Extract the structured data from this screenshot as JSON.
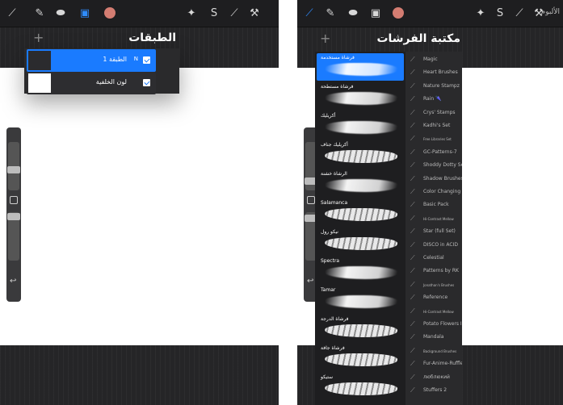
{
  "top_label": "الألبوم",
  "colors": {
    "accent": "#1a7bff",
    "current_color": "#d47d72",
    "canvas": "#ffffff",
    "panel": "#1b1b1d"
  },
  "icons": [
    "brush-icon",
    "smudge-icon",
    "eraser-icon",
    "layers-icon",
    "color-dot",
    "adjustments-icon",
    "selection-icon",
    "transform-icon",
    "wrench-icon"
  ],
  "layers": {
    "title": "الطبقات",
    "add_label": "+",
    "items": [
      {
        "name": "الطبقة 1",
        "mode": "N",
        "active": true,
        "thumbnail": "#2b2b2e"
      },
      {
        "name": "لون الخلفية",
        "mode": "",
        "active": false,
        "thumbnail": "#ffffff"
      }
    ]
  },
  "brush_library": {
    "title": "مكتبة الفرشات",
    "add_label": "+",
    "categories": [
      {
        "name": "فرشاة مستخدمة",
        "active": true,
        "style": "soft"
      },
      {
        "name": "فرشاة مستطحة",
        "active": false,
        "style": "soft"
      },
      {
        "name": "أكريليك",
        "active": false,
        "style": "soft"
      },
      {
        "name": "أكريليك جناف",
        "active": false,
        "style": "rough"
      },
      {
        "name": "الرشاة خشنة",
        "active": false,
        "style": "soft"
      },
      {
        "name": "Salamanca",
        "active": false,
        "style": "rough"
      },
      {
        "name": "نيكو رول",
        "active": false,
        "style": "rough"
      },
      {
        "name": "Spectra",
        "active": false,
        "style": "soft"
      },
      {
        "name": "Tamar",
        "active": false,
        "style": "soft"
      },
      {
        "name": "فرشاة الدرجة",
        "active": false,
        "style": "rough"
      },
      {
        "name": "فرشاة جافة",
        "active": false,
        "style": "rough"
      },
      {
        "name": "ستيكو",
        "active": false,
        "style": "rough"
      }
    ],
    "brush_sets": [
      {
        "name": "Magic",
        "tiny": false
      },
      {
        "name": "Heart Brushes",
        "tiny": false
      },
      {
        "name": "Nature Stampz",
        "tiny": false
      },
      {
        "name": "Rain 🌂",
        "tiny": false
      },
      {
        "name": "Crys' Stamps",
        "tiny": false
      },
      {
        "name": "Kadhi's Set",
        "tiny": false
      },
      {
        "name": "Free Libraries Set",
        "tiny": true
      },
      {
        "name": "GC-Patterns-7",
        "tiny": false
      },
      {
        "name": "Shoddy Dotty Set",
        "tiny": false
      },
      {
        "name": "Shadow Brushes",
        "tiny": false
      },
      {
        "name": "Color Changing",
        "tiny": false
      },
      {
        "name": "Basic Pack",
        "tiny": false
      },
      {
        "name": "Hi-Contrast Mellow",
        "tiny": true
      },
      {
        "name": "Star (full Set)",
        "tiny": false
      },
      {
        "name": "DISCO in ACID",
        "tiny": false
      },
      {
        "name": "Celestial",
        "tiny": false
      },
      {
        "name": "Patterns by RK",
        "tiny": false
      },
      {
        "name": "Jonathan's Brushes",
        "tiny": true
      },
      {
        "name": "Reference",
        "tiny": false
      },
      {
        "name": "Hi-Contrast Mellow",
        "tiny": true
      },
      {
        "name": "Potato Flowers III",
        "tiny": false
      },
      {
        "name": "Mandala",
        "tiny": false
      },
      {
        "name": "Background Brushes",
        "tiny": true
      },
      {
        "name": "Fur-Anime-Ruffles",
        "tiny": false
      },
      {
        "name": "люблюкий",
        "tiny": false
      },
      {
        "name": "Stuffers 2",
        "tiny": false
      }
    ]
  }
}
